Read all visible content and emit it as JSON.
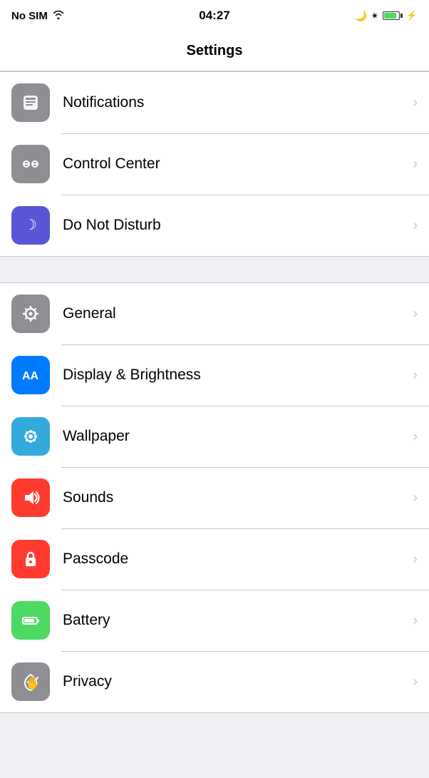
{
  "statusBar": {
    "carrier": "No SIM",
    "time": "04:27",
    "wifiSymbol": "📶"
  },
  "header": {
    "title": "Settings"
  },
  "groups": [
    {
      "id": "group1",
      "items": [
        {
          "id": "notifications",
          "label": "Notifications",
          "iconClass": "icon-notifications",
          "iconSymbol": "🔔",
          "iconSvg": "notifications"
        },
        {
          "id": "control-center",
          "label": "Control Center",
          "iconClass": "icon-control-center",
          "iconSymbol": "⊕",
          "iconSvg": "control-center"
        },
        {
          "id": "do-not-disturb",
          "label": "Do Not Disturb",
          "iconClass": "icon-do-not-disturb",
          "iconSymbol": "☾",
          "iconSvg": "dnd"
        }
      ]
    },
    {
      "id": "group2",
      "items": [
        {
          "id": "general",
          "label": "General",
          "iconClass": "icon-general",
          "iconSymbol": "⚙",
          "iconSvg": "general"
        },
        {
          "id": "display",
          "label": "Display & Brightness",
          "iconClass": "icon-display",
          "iconSymbol": "AA",
          "iconSvg": "display"
        },
        {
          "id": "wallpaper",
          "label": "Wallpaper",
          "iconClass": "icon-wallpaper",
          "iconSymbol": "❋",
          "iconSvg": "wallpaper"
        },
        {
          "id": "sounds",
          "label": "Sounds",
          "iconClass": "icon-sounds",
          "iconSymbol": "🔊",
          "iconSvg": "sounds"
        },
        {
          "id": "passcode",
          "label": "Passcode",
          "iconClass": "icon-passcode",
          "iconSymbol": "🔒",
          "iconSvg": "passcode"
        },
        {
          "id": "battery",
          "label": "Battery",
          "iconClass": "icon-battery",
          "iconSymbol": "🔋",
          "iconSvg": "battery"
        },
        {
          "id": "privacy",
          "label": "Privacy",
          "iconClass": "icon-privacy",
          "iconSymbol": "✋",
          "iconSvg": "privacy"
        }
      ]
    }
  ],
  "chevron": "›"
}
